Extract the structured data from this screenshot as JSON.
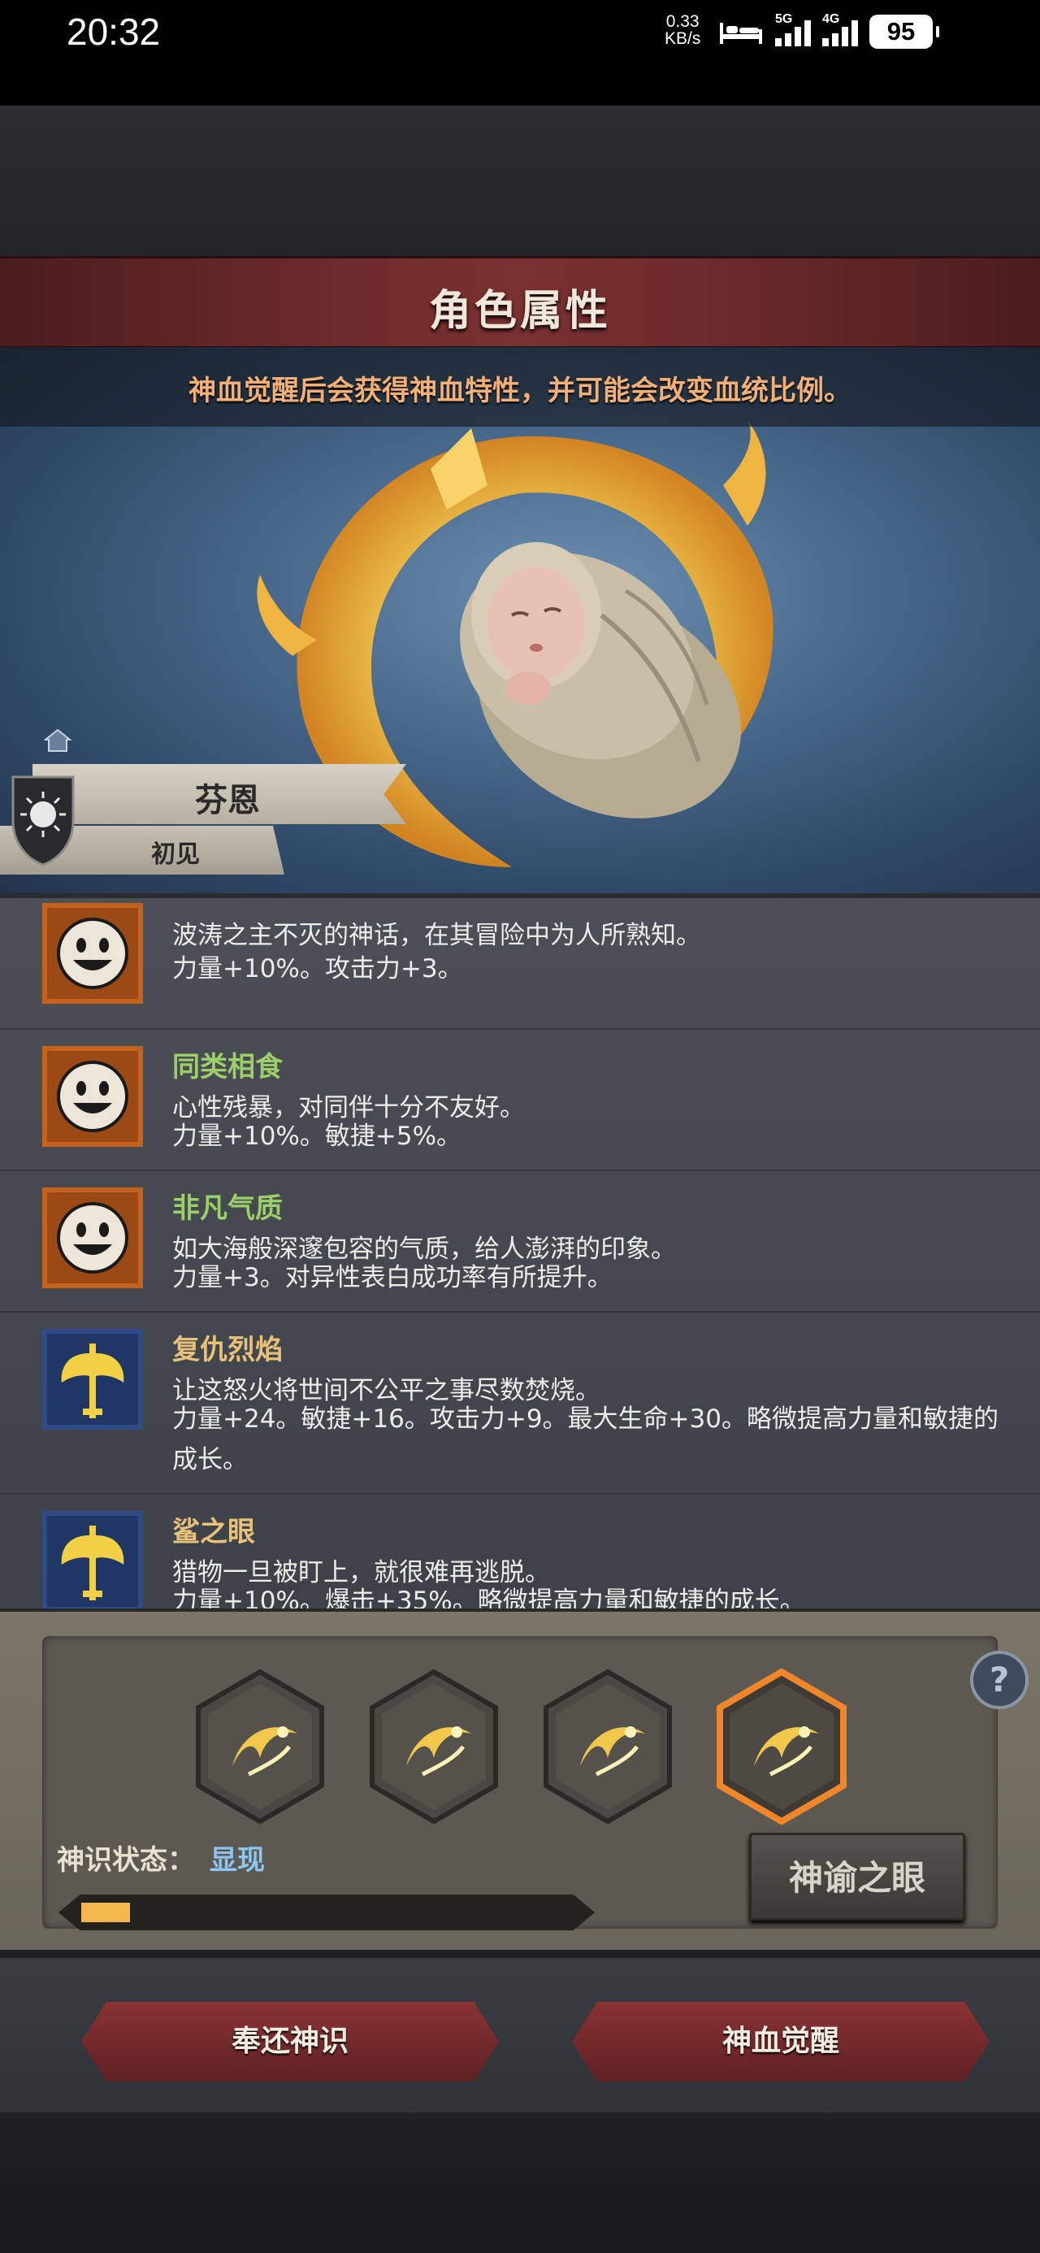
{
  "status_bar": {
    "time": "20:32",
    "net_speed_value": "0.33",
    "net_speed_unit": "KB/s",
    "signal_1": "5G",
    "signal_2": "4G",
    "battery": "95"
  },
  "title": "角色属性",
  "hint": "神血觉醒后会获得神血特性，并可能会改变血统比例。",
  "character": {
    "name": "芬恩",
    "relation": "初见"
  },
  "traits": [
    {
      "name": "",
      "name_color": "#9ccf6a",
      "icon": "smile-icon",
      "description": "波涛之主不灭的神话，在其冒险中为人所熟知。",
      "effect": "力量+10%。攻击力+3。"
    },
    {
      "name": "同类相食",
      "name_color": "#9ccf6a",
      "icon": "smile-icon",
      "description": "心性残暴，对同伴十分不友好。",
      "effect": "力量+10%。敏捷+5%。"
    },
    {
      "name": "非凡气质",
      "name_color": "#9ccf6a",
      "icon": "smile-icon",
      "description": "如大海般深邃包容的气质，给人澎湃的印象。",
      "effect": "力量+3。对异性表白成功率有所提升。"
    },
    {
      "name": "复仇烈焰",
      "name_color": "#e8c27a",
      "icon": "axe-icon",
      "description": "让这怒火将世间不公平之事尽数焚烧。",
      "effect": "力量+24。敏捷+16。攻击力+9。最大生命+30。略微提高力量和敏捷的成长。"
    },
    {
      "name": "鲨之眼",
      "name_color": "#e8c27a",
      "icon": "axe-icon",
      "description": "猎物一旦被盯上，就很难再逃脱。",
      "effect": "力量+10%。爆击+35%。略微提高力量和敏捷的成长。"
    }
  ],
  "divine": {
    "status_label": "神识状态：",
    "status_value": "显现",
    "progress": 0.1,
    "oracle_button": "神谕之眼",
    "slots": [
      "trident-icon",
      "trident-icon",
      "trident-icon",
      "trident-icon"
    ]
  },
  "footer": {
    "return_button": "奉还神识",
    "awaken_button": "神血觉醒"
  },
  "colors": {
    "accent_red": "#7a3130",
    "hint_orange": "#f2b077",
    "status_blue": "#8cc4f2",
    "progress_fill": "#f3b74c"
  }
}
